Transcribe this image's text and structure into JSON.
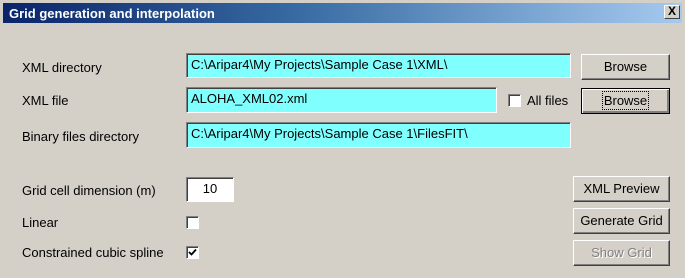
{
  "window": {
    "title": "Grid generation and interpolation",
    "close_glyph": "X"
  },
  "form": {
    "xml_directory_label": "XML directory",
    "xml_directory_value": "C:\\Aripar4\\My Projects\\Sample Case 1\\XML\\",
    "xml_file_label": "XML file",
    "xml_file_value": "ALOHA_XML02.xml",
    "all_files_label": "All files",
    "all_files_checked": false,
    "binary_dir_label": "Binary files directory",
    "binary_dir_value": "C:\\Aripar4\\My Projects\\Sample Case 1\\FilesFIT\\",
    "grid_cell_label": "Grid cell dimension (m)",
    "grid_cell_value": "10",
    "linear_label": "Linear",
    "linear_checked": false,
    "cubic_label": "Constrained cubic spline",
    "cubic_checked": true
  },
  "buttons": {
    "browse_1": "Browse",
    "browse_2": "Browse",
    "xml_preview": "XML Preview",
    "generate_grid": "Generate Grid",
    "show_grid": "Show Grid"
  },
  "colors": {
    "field_background": "#80ffff",
    "titlebar_start": "#0a246a",
    "titlebar_end": "#a6caf0",
    "dialog_face": "#d4d0c8"
  }
}
